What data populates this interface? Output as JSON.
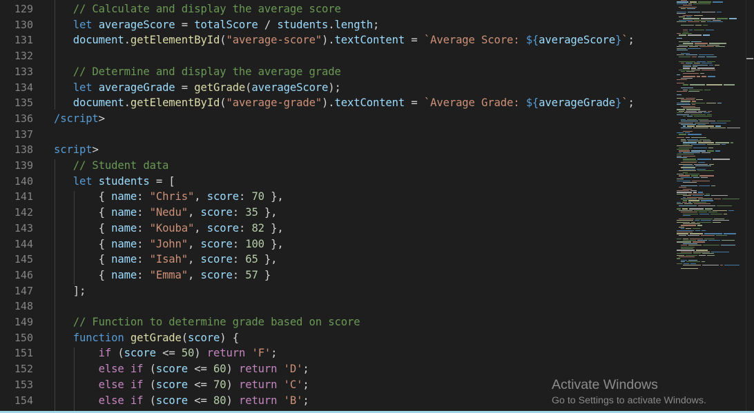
{
  "editor": {
    "lines": [
      {
        "num": "129",
        "tokens": [
          {
            "t": "   ",
            "c": "p"
          },
          {
            "t": "// Calculate and display the average score",
            "c": "c"
          }
        ]
      },
      {
        "num": "130",
        "tokens": [
          {
            "t": "   ",
            "c": "p"
          },
          {
            "t": "let",
            "c": "k"
          },
          {
            "t": " ",
            "c": "p"
          },
          {
            "t": "averageScore",
            "c": "v"
          },
          {
            "t": " = ",
            "c": "p"
          },
          {
            "t": "totalScore",
            "c": "v"
          },
          {
            "t": " / ",
            "c": "p"
          },
          {
            "t": "students",
            "c": "v"
          },
          {
            "t": ".",
            "c": "p"
          },
          {
            "t": "length",
            "c": "v"
          },
          {
            "t": ";",
            "c": "p"
          }
        ]
      },
      {
        "num": "131",
        "tokens": [
          {
            "t": "   ",
            "c": "p"
          },
          {
            "t": "document",
            "c": "v"
          },
          {
            "t": ".",
            "c": "p"
          },
          {
            "t": "getElementById",
            "c": "f"
          },
          {
            "t": "(",
            "c": "p"
          },
          {
            "t": "\"average-score\"",
            "c": "s"
          },
          {
            "t": ").",
            "c": "p"
          },
          {
            "t": "textContent",
            "c": "v"
          },
          {
            "t": " = ",
            "c": "p"
          },
          {
            "t": "`Average Score: ",
            "c": "s"
          },
          {
            "t": "${",
            "c": "k"
          },
          {
            "t": "averageScore",
            "c": "v"
          },
          {
            "t": "}",
            "c": "k"
          },
          {
            "t": "`",
            "c": "s"
          },
          {
            "t": ";",
            "c": "p"
          }
        ]
      },
      {
        "num": "132",
        "tokens": []
      },
      {
        "num": "133",
        "tokens": [
          {
            "t": "   ",
            "c": "p"
          },
          {
            "t": "// Determine and display the average grade",
            "c": "c"
          }
        ]
      },
      {
        "num": "134",
        "tokens": [
          {
            "t": "   ",
            "c": "p"
          },
          {
            "t": "let",
            "c": "k"
          },
          {
            "t": " ",
            "c": "p"
          },
          {
            "t": "averageGrade",
            "c": "v"
          },
          {
            "t": " = ",
            "c": "p"
          },
          {
            "t": "getGrade",
            "c": "f"
          },
          {
            "t": "(",
            "c": "p"
          },
          {
            "t": "averageScore",
            "c": "v"
          },
          {
            "t": ");",
            "c": "p"
          }
        ]
      },
      {
        "num": "135",
        "tokens": [
          {
            "t": "   ",
            "c": "p"
          },
          {
            "t": "document",
            "c": "v"
          },
          {
            "t": ".",
            "c": "p"
          },
          {
            "t": "getElementById",
            "c": "f"
          },
          {
            "t": "(",
            "c": "p"
          },
          {
            "t": "\"average-grade\"",
            "c": "s"
          },
          {
            "t": ").",
            "c": "p"
          },
          {
            "t": "textContent",
            "c": "v"
          },
          {
            "t": " = ",
            "c": "p"
          },
          {
            "t": "`Average Grade: ",
            "c": "s"
          },
          {
            "t": "${",
            "c": "k"
          },
          {
            "t": "averageGrade",
            "c": "v"
          },
          {
            "t": "}",
            "c": "k"
          },
          {
            "t": "`",
            "c": "s"
          },
          {
            "t": ";",
            "c": "p"
          }
        ]
      },
      {
        "num": "136",
        "tokens": [
          {
            "t": "/script",
            "c": "t"
          },
          {
            "t": ">",
            "c": "p"
          }
        ]
      },
      {
        "num": "137",
        "tokens": []
      },
      {
        "num": "138",
        "tokens": [
          {
            "t": "script",
            "c": "t"
          },
          {
            "t": ">",
            "c": "p"
          }
        ]
      },
      {
        "num": "139",
        "tokens": [
          {
            "t": "   ",
            "c": "p"
          },
          {
            "t": "// Student data",
            "c": "c"
          }
        ]
      },
      {
        "num": "140",
        "tokens": [
          {
            "t": "   ",
            "c": "p"
          },
          {
            "t": "let",
            "c": "k"
          },
          {
            "t": " ",
            "c": "p"
          },
          {
            "t": "students",
            "c": "v"
          },
          {
            "t": " = [",
            "c": "p"
          }
        ]
      },
      {
        "num": "141",
        "tokens": [
          {
            "t": "       { ",
            "c": "p"
          },
          {
            "t": "name",
            "c": "v"
          },
          {
            "t": ": ",
            "c": "p"
          },
          {
            "t": "\"Chris\"",
            "c": "s"
          },
          {
            "t": ", ",
            "c": "p"
          },
          {
            "t": "score",
            "c": "v"
          },
          {
            "t": ": ",
            "c": "p"
          },
          {
            "t": "70",
            "c": "n"
          },
          {
            "t": " },",
            "c": "p"
          }
        ]
      },
      {
        "num": "142",
        "tokens": [
          {
            "t": "       { ",
            "c": "p"
          },
          {
            "t": "name",
            "c": "v"
          },
          {
            "t": ": ",
            "c": "p"
          },
          {
            "t": "\"Nedu\"",
            "c": "s"
          },
          {
            "t": ", ",
            "c": "p"
          },
          {
            "t": "score",
            "c": "v"
          },
          {
            "t": ": ",
            "c": "p"
          },
          {
            "t": "35",
            "c": "n"
          },
          {
            "t": " },",
            "c": "p"
          }
        ]
      },
      {
        "num": "143",
        "tokens": [
          {
            "t": "       { ",
            "c": "p"
          },
          {
            "t": "name",
            "c": "v"
          },
          {
            "t": ": ",
            "c": "p"
          },
          {
            "t": "\"Kouba\"",
            "c": "s"
          },
          {
            "t": ", ",
            "c": "p"
          },
          {
            "t": "score",
            "c": "v"
          },
          {
            "t": ": ",
            "c": "p"
          },
          {
            "t": "82",
            "c": "n"
          },
          {
            "t": " },",
            "c": "p"
          }
        ]
      },
      {
        "num": "144",
        "tokens": [
          {
            "t": "       { ",
            "c": "p"
          },
          {
            "t": "name",
            "c": "v"
          },
          {
            "t": ": ",
            "c": "p"
          },
          {
            "t": "\"John\"",
            "c": "s"
          },
          {
            "t": ", ",
            "c": "p"
          },
          {
            "t": "score",
            "c": "v"
          },
          {
            "t": ": ",
            "c": "p"
          },
          {
            "t": "100",
            "c": "n"
          },
          {
            "t": " },",
            "c": "p"
          }
        ]
      },
      {
        "num": "145",
        "tokens": [
          {
            "t": "       { ",
            "c": "p"
          },
          {
            "t": "name",
            "c": "v"
          },
          {
            "t": ": ",
            "c": "p"
          },
          {
            "t": "\"Isah\"",
            "c": "s"
          },
          {
            "t": ", ",
            "c": "p"
          },
          {
            "t": "score",
            "c": "v"
          },
          {
            "t": ": ",
            "c": "p"
          },
          {
            "t": "65",
            "c": "n"
          },
          {
            "t": " },",
            "c": "p"
          }
        ]
      },
      {
        "num": "146",
        "tokens": [
          {
            "t": "       { ",
            "c": "p"
          },
          {
            "t": "name",
            "c": "v"
          },
          {
            "t": ": ",
            "c": "p"
          },
          {
            "t": "\"Emma\"",
            "c": "s"
          },
          {
            "t": ", ",
            "c": "p"
          },
          {
            "t": "score",
            "c": "v"
          },
          {
            "t": ": ",
            "c": "p"
          },
          {
            "t": "57",
            "c": "n"
          },
          {
            "t": " }",
            "c": "p"
          }
        ]
      },
      {
        "num": "147",
        "tokens": [
          {
            "t": "   ];",
            "c": "p"
          }
        ]
      },
      {
        "num": "148",
        "tokens": []
      },
      {
        "num": "149",
        "tokens": [
          {
            "t": "   ",
            "c": "p"
          },
          {
            "t": "// Function to determine grade based on score",
            "c": "c"
          }
        ]
      },
      {
        "num": "150",
        "tokens": [
          {
            "t": "   ",
            "c": "p"
          },
          {
            "t": "function",
            "c": "k"
          },
          {
            "t": " ",
            "c": "p"
          },
          {
            "t": "getGrade",
            "c": "f"
          },
          {
            "t": "(",
            "c": "p"
          },
          {
            "t": "score",
            "c": "v"
          },
          {
            "t": ") {",
            "c": "p"
          }
        ]
      },
      {
        "num": "151",
        "tokens": [
          {
            "t": "       ",
            "c": "p"
          },
          {
            "t": "if",
            "c": "kc"
          },
          {
            "t": " (",
            "c": "p"
          },
          {
            "t": "score",
            "c": "v"
          },
          {
            "t": " <= ",
            "c": "p"
          },
          {
            "t": "50",
            "c": "n"
          },
          {
            "t": ") ",
            "c": "p"
          },
          {
            "t": "return",
            "c": "kc"
          },
          {
            "t": " ",
            "c": "p"
          },
          {
            "t": "'F'",
            "c": "s"
          },
          {
            "t": ";",
            "c": "p"
          }
        ]
      },
      {
        "num": "152",
        "tokens": [
          {
            "t": "       ",
            "c": "p"
          },
          {
            "t": "else",
            "c": "kc"
          },
          {
            "t": " ",
            "c": "p"
          },
          {
            "t": "if",
            "c": "kc"
          },
          {
            "t": " (",
            "c": "p"
          },
          {
            "t": "score",
            "c": "v"
          },
          {
            "t": " <= ",
            "c": "p"
          },
          {
            "t": "60",
            "c": "n"
          },
          {
            "t": ") ",
            "c": "p"
          },
          {
            "t": "return",
            "c": "kc"
          },
          {
            "t": " ",
            "c": "p"
          },
          {
            "t": "'D'",
            "c": "s"
          },
          {
            "t": ";",
            "c": "p"
          }
        ]
      },
      {
        "num": "153",
        "tokens": [
          {
            "t": "       ",
            "c": "p"
          },
          {
            "t": "else",
            "c": "kc"
          },
          {
            "t": " ",
            "c": "p"
          },
          {
            "t": "if",
            "c": "kc"
          },
          {
            "t": " (",
            "c": "p"
          },
          {
            "t": "score",
            "c": "v"
          },
          {
            "t": " <= ",
            "c": "p"
          },
          {
            "t": "70",
            "c": "n"
          },
          {
            "t": ") ",
            "c": "p"
          },
          {
            "t": "return",
            "c": "kc"
          },
          {
            "t": " ",
            "c": "p"
          },
          {
            "t": "'C'",
            "c": "s"
          },
          {
            "t": ";",
            "c": "p"
          }
        ]
      },
      {
        "num": "154",
        "tokens": [
          {
            "t": "       ",
            "c": "p"
          },
          {
            "t": "else",
            "c": "kc"
          },
          {
            "t": " ",
            "c": "p"
          },
          {
            "t": "if",
            "c": "kc"
          },
          {
            "t": " (",
            "c": "p"
          },
          {
            "t": "score",
            "c": "v"
          },
          {
            "t": " <= ",
            "c": "p"
          },
          {
            "t": "80",
            "c": "n"
          },
          {
            "t": ") ",
            "c": "p"
          },
          {
            "t": "return",
            "c": "kc"
          },
          {
            "t": " ",
            "c": "p"
          },
          {
            "t": "'B'",
            "c": "s"
          },
          {
            "t": ";",
            "c": "p"
          }
        ]
      }
    ]
  },
  "watermark": {
    "title": "Activate Windows",
    "subtitle": "Go to Settings to activate Windows."
  },
  "colors": {
    "background": "#1e1e1e",
    "line_number": "#858585",
    "comment": "#6a9955",
    "keyword": "#569cd6",
    "control_keyword": "#c586c0",
    "variable": "#9cdcfe",
    "function": "#dcdcaa",
    "string": "#ce9178",
    "number": "#b5cea8"
  }
}
